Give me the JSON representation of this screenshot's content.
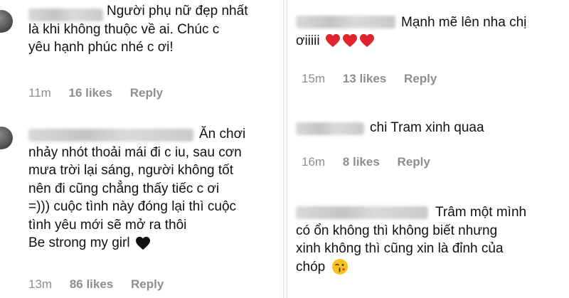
{
  "left": {
    "comments": [
      {
        "lines": [
          "Người phụ nữ đẹp nhất",
          "là khi không thuộc về ai. Chúc c",
          "yêu hạnh phúc nhé c ơi!"
        ],
        "time": "11m",
        "likes": "16 likes",
        "reply": "Reply"
      },
      {
        "lines": [
          "Ăn chơi",
          "nhảy nhót thoải mái đi c iu, sau cơn",
          "mưa trời lại sáng, người không tốt",
          "nên đi cũng chẳng thấy tiếc c ơi",
          "=))) cuộc tình này đóng lại thì cuộc",
          "tình yêu mới sẽ mở ra thôi",
          "Be strong my girl"
        ],
        "emoji": "black-heart-icon",
        "time": "13m",
        "likes": "86 likes",
        "reply": "Reply"
      }
    ]
  },
  "right": {
    "comments": [
      {
        "lines": [
          "Mạnh mẽ lên nha chị",
          "ơiiiii"
        ],
        "emoji": "red-heart-icon x3",
        "time": "15m",
        "likes": "13 likes",
        "reply": "Reply"
      },
      {
        "lines": [
          "chi Tram xinh quaa"
        ],
        "time": "16m",
        "likes": "8 likes",
        "reply": "Reply"
      },
      {
        "lines": [
          "Trâm một mình",
          "có ổn không thì không biết nhưng",
          "xinh không thì cũng xin là đỉnh của",
          "chóp"
        ],
        "emoji": "kiss-face-icon"
      }
    ]
  },
  "colors": {
    "text": "#111111",
    "meta": "#8e8e8e",
    "heart_red": "#e0242c",
    "heart_black": "#111111"
  }
}
